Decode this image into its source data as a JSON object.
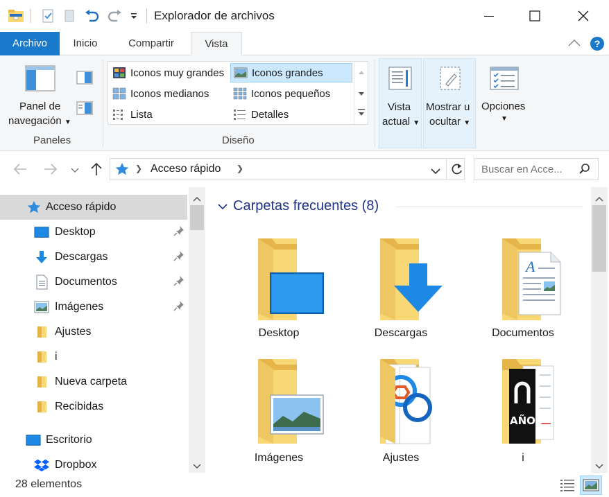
{
  "window": {
    "title": "Explorador de archivos"
  },
  "ribbon_tabs": [
    {
      "label": "Archivo"
    },
    {
      "label": "Inicio"
    },
    {
      "label": "Compartir"
    },
    {
      "label": "Vista"
    }
  ],
  "ribbon": {
    "panes": {
      "nav_pane_line1": "Panel de",
      "nav_pane_line2": "navegación",
      "group_label": "Paneles"
    },
    "layout": {
      "items": [
        {
          "label": "Iconos muy grandes"
        },
        {
          "label": "Iconos grandes"
        },
        {
          "label": "Iconos medianos"
        },
        {
          "label": "Iconos pequeños"
        },
        {
          "label": "Lista"
        },
        {
          "label": "Detalles"
        }
      ],
      "selected": "Iconos grandes",
      "group_label": "Diseño"
    },
    "current_view": {
      "line1": "Vista",
      "line2": "actual"
    },
    "show_hide": {
      "line1": "Mostrar u",
      "line2": "ocultar"
    },
    "options": {
      "label": "Opciones"
    }
  },
  "address_bar": {
    "path": "Acceso rápido",
    "search_placeholder": "Buscar en Acce..."
  },
  "nav_pane": {
    "items": [
      {
        "label": "Acceso rápido",
        "icon": "star-icon",
        "pinned": false,
        "selected": true
      },
      {
        "label": "Desktop",
        "icon": "desktop-icon",
        "pinned": true
      },
      {
        "label": "Descargas",
        "icon": "download-icon",
        "pinned": true
      },
      {
        "label": "Documentos",
        "icon": "document-icon",
        "pinned": true
      },
      {
        "label": "Imágenes",
        "icon": "pictures-icon",
        "pinned": true
      },
      {
        "label": "Ajustes",
        "icon": "folder-icon",
        "pinned": false
      },
      {
        "label": "i",
        "icon": "folder-icon",
        "pinned": false
      },
      {
        "label": "Nueva carpeta",
        "icon": "folder-icon",
        "pinned": false
      },
      {
        "label": "Recibidas",
        "icon": "folder-icon",
        "pinned": false
      },
      {
        "label": "Escritorio",
        "icon": "desktop-icon",
        "pinned": false
      },
      {
        "label": "Dropbox",
        "icon": "dropbox-icon",
        "pinned": false
      }
    ]
  },
  "content": {
    "group_title": "Carpetas frecuentes (8)",
    "tiles": [
      {
        "label": "Desktop"
      },
      {
        "label": "Descargas"
      },
      {
        "label": "Documentos"
      },
      {
        "label": "Imágenes"
      },
      {
        "label": "Ajustes"
      },
      {
        "label": "i"
      }
    ]
  },
  "status": {
    "item_count": "28 elementos"
  },
  "colors": {
    "accent": "#1979ca",
    "selection": "#cce8ff",
    "group_title": "#1e3287",
    "folder": "#f8d775"
  }
}
